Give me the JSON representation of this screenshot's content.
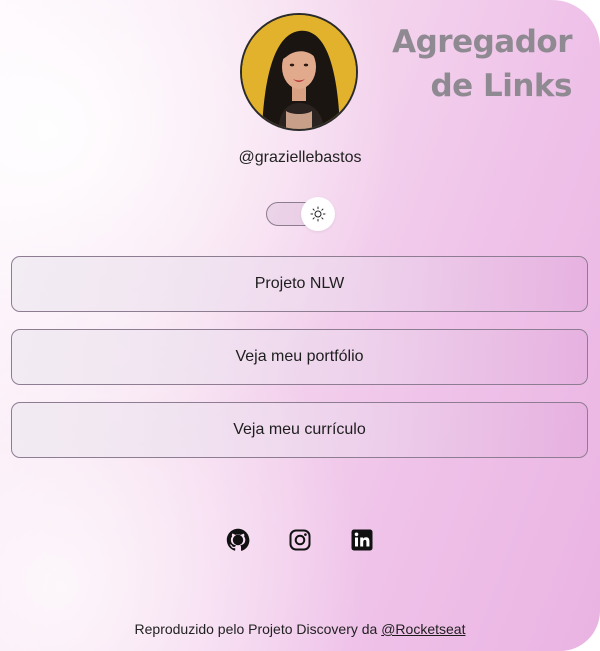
{
  "title": {
    "line1": "Agregador",
    "line2": "de Links"
  },
  "profile": {
    "username": "@graziellebastos",
    "avatar_icon": "profile-photo"
  },
  "theme_switch": {
    "icon": "sun-icon"
  },
  "links": [
    {
      "label": "Projeto NLW"
    },
    {
      "label": "Veja meu portfólio"
    },
    {
      "label": "Veja meu currículo"
    }
  ],
  "socials": [
    {
      "icon": "github-icon"
    },
    {
      "icon": "instagram-icon"
    },
    {
      "icon": "linkedin-icon"
    }
  ],
  "footer": {
    "text": "Reproduzido pelo Projeto Discovery da ",
    "link": "@Rocketseat"
  },
  "colors": {
    "title": "#8f8a92",
    "accent": "#eab3e2",
    "border": "#8e7d92"
  }
}
